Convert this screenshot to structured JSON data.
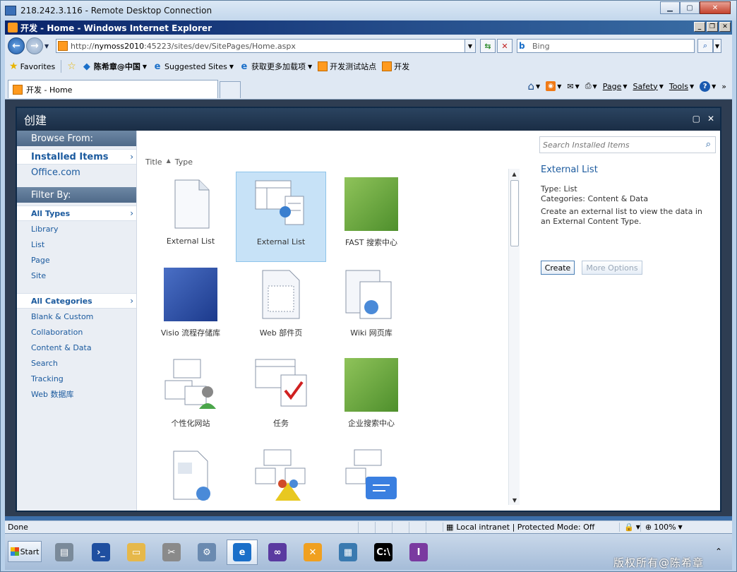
{
  "rdp": {
    "title": "218.242.3.116 - Remote Desktop Connection"
  },
  "ie": {
    "title": "开发 - Home - Windows Internet Explorer",
    "address": {
      "url_prefix": "http://",
      "url_host": "nymoss2010",
      "url_rest": ":45223/sites/dev/SitePages/Home.aspx"
    },
    "search_placeholder": "Bing",
    "favorites": {
      "label": "Favorites",
      "items": [
        "陈希章@中国",
        "Suggested Sites",
        "获取更多加载项",
        "开发测试站点",
        "开发"
      ]
    },
    "tab": {
      "label": "开发 - Home"
    },
    "commands": {
      "page": "Page",
      "safety": "Safety",
      "tools": "Tools"
    }
  },
  "dialog": {
    "title": "创建",
    "browse_from": {
      "header": "Browse From:",
      "items": [
        "Installed Items",
        "Office.com"
      ]
    },
    "filter_by": {
      "header": "Filter By:",
      "types": [
        "All Types",
        "Library",
        "List",
        "Page",
        "Site"
      ],
      "categories": [
        "All Categories",
        "Blank & Custom",
        "Collaboration",
        "Content & Data",
        "Search",
        "Tracking",
        "Web 数据库"
      ]
    },
    "sort": {
      "title": "Title",
      "type": "Type"
    },
    "tiles": [
      {
        "label": "External List"
      },
      {
        "label": "External List"
      },
      {
        "label": "FAST 搜索中心"
      },
      {
        "label": "Visio 流程存储库"
      },
      {
        "label": "Web 部件页"
      },
      {
        "label": "Wiki 网页库"
      },
      {
        "label": "个性化网站"
      },
      {
        "label": "任务"
      },
      {
        "label": "企业搜索中心"
      },
      {
        "label": ""
      },
      {
        "label": ""
      },
      {
        "label": ""
      }
    ],
    "detail": {
      "search_placeholder": "Search Installed Items",
      "title": "External List",
      "type_line": "Type: List",
      "categories_line": "Categories: Content & Data",
      "description": "Create an external list to view the data in an External Content Type.",
      "create_label": "Create",
      "more_label": "More Options"
    }
  },
  "status": {
    "done": "Done",
    "zone": "Local intranet | Protected Mode: Off",
    "zoom": "100%"
  },
  "taskbar": {
    "start_label": "Start",
    "copyright": "版权所有@陈希章"
  }
}
